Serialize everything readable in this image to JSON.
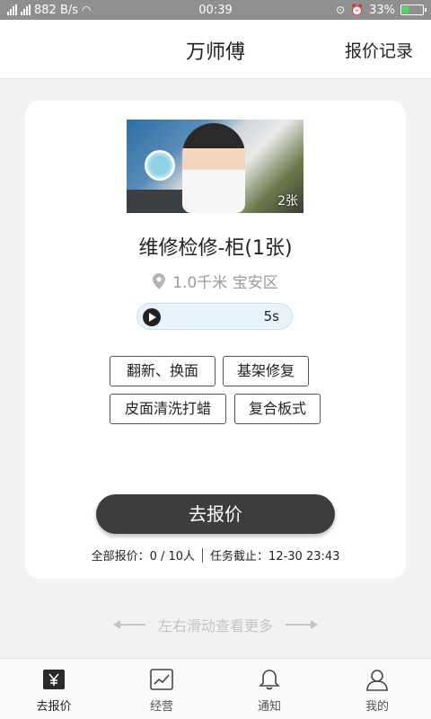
{
  "status": {
    "network": "882 B/s",
    "time": "00:39",
    "battery": "33%",
    "battery_level": 0.33
  },
  "header": {
    "title": "万师傅",
    "records_label": "报价记录"
  },
  "card": {
    "image_count": "2张",
    "job_title": "维修检修-柜(1张)",
    "location": "1.0千米 宝安区",
    "voice_duration": "5s",
    "tags": [
      "翻新、换面",
      "基架修复",
      "皮面清洗打蜡",
      "复合板式"
    ],
    "quote_button": "去报价",
    "total_quotes": "全部报价：0 / 10人",
    "deadline": "任务截止：12-30 23:43"
  },
  "swipe_hint": "左右滑动查看更多",
  "nav": {
    "items": [
      {
        "label": "去报价",
        "icon": "yen-icon"
      },
      {
        "label": "经营",
        "icon": "chart-icon"
      },
      {
        "label": "通知",
        "icon": "bell-icon"
      },
      {
        "label": "我的",
        "icon": "user-icon"
      }
    ]
  },
  "colors": {
    "primary_button": "#3e3d3d",
    "voice_bg": "#e8f2fb",
    "hint_gray": "#c4c4c4"
  }
}
